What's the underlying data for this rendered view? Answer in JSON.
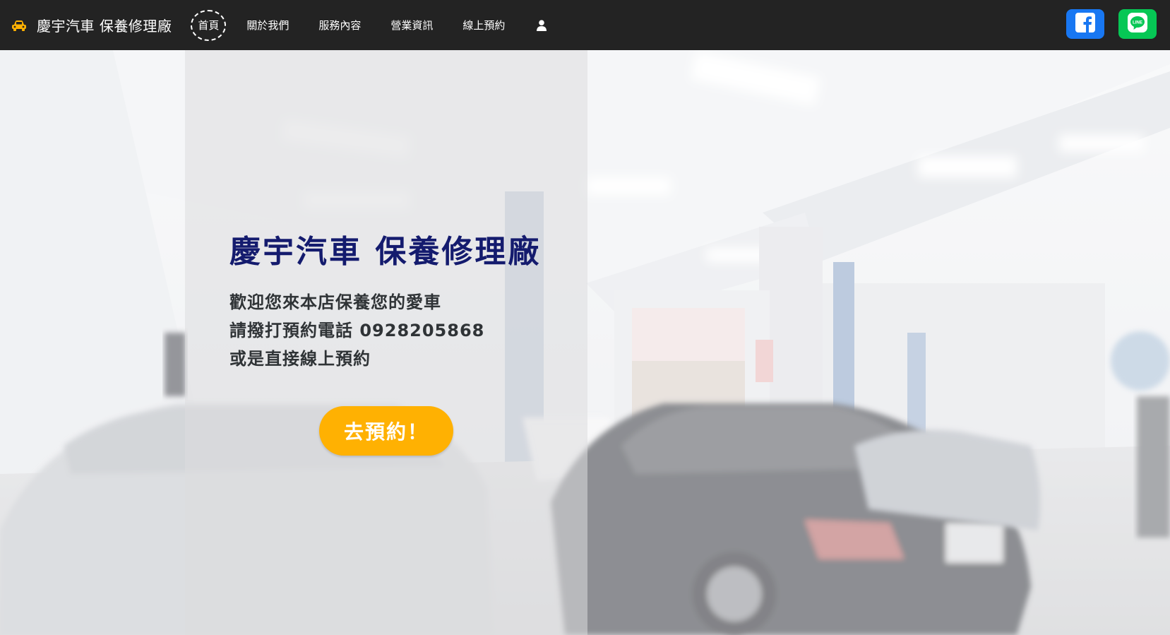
{
  "navbar": {
    "brand_text": "慶宇汽車 保養修理廠",
    "brand_icon": "car-icon",
    "brand_icon_color": "#ffb102",
    "items": [
      {
        "label": "首頁",
        "active": true
      },
      {
        "label": "關於我們"
      },
      {
        "label": "服務內容"
      },
      {
        "label": "營業資訊"
      },
      {
        "label": "線上預約"
      }
    ],
    "user_icon": "user-icon",
    "social": [
      {
        "name": "facebook-icon",
        "color": "#1877f2"
      },
      {
        "name": "line-icon",
        "text": "LINE",
        "color": "#06c755"
      }
    ]
  },
  "hero": {
    "title": "慶宇汽車 保養修理廠",
    "lines": [
      "歡迎您來本店保養您的愛車",
      "請撥打預約電話 0928205868",
      "或是直接線上預約"
    ],
    "cta_label": "去預約！",
    "cta_color": "#ffb102",
    "title_color": "#141b6e"
  }
}
